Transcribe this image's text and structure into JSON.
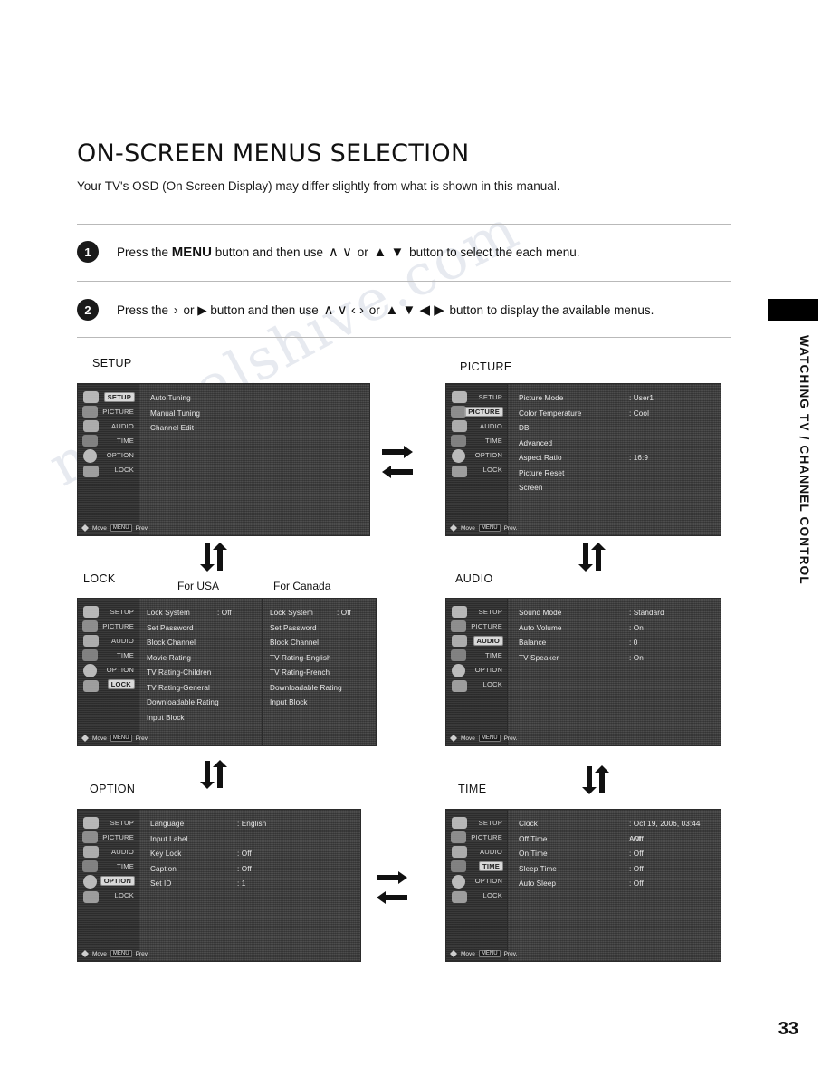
{
  "page": {
    "title": "ON-SCREEN MENUS SELECTION",
    "intro": "Your TV's OSD (On Screen Display) may differ slightly from what is shown in this manual.",
    "number": "33",
    "side_tab_text": "WATCHING TV / CHANNEL CONTROL",
    "watermark": "manualshive.com"
  },
  "steps": [
    {
      "num": "1",
      "pre": "Press the ",
      "key": "MENU",
      "mid": " button and then use ",
      "keys1": "∧ ∨",
      "or": " or ",
      "keys2": "▲ ▼",
      "post": " button to select the each menu."
    },
    {
      "num": "2",
      "pre": "Press the ",
      "key": "›",
      "mid": " or ▶ button and then use ",
      "keys1": "∧ ∨  ‹ ›",
      "or": " or ",
      "keys2": "▲ ▼ ◀ ▶",
      "post": " button to display the available menus."
    }
  ],
  "rail": {
    "items": [
      "SETUP",
      "PICTURE",
      "AUDIO",
      "TIME",
      "OPTION",
      "LOCK"
    ],
    "foot_move": "Move",
    "foot_key": "MENU",
    "foot_prev": "Prev."
  },
  "menus": {
    "setup": {
      "label": "SETUP",
      "selected": "SETUP",
      "rows": [
        {
          "k": "Auto Tuning",
          "v": ""
        },
        {
          "k": "Manual Tuning",
          "v": ""
        },
        {
          "k": "Channel Edit",
          "v": ""
        }
      ]
    },
    "picture": {
      "label": "PICTURE",
      "selected": "PICTURE",
      "rows": [
        {
          "k": "Picture Mode",
          "v": ": User1"
        },
        {
          "k": "Color Temperature",
          "v": ": Cool"
        },
        {
          "k": "DB",
          "v": ""
        },
        {
          "k": "Advanced",
          "v": ""
        },
        {
          "k": "Aspect Ratio",
          "v": ": 16:9"
        },
        {
          "k": "Picture Reset",
          "v": ""
        },
        {
          "k": "Screen",
          "v": ""
        }
      ]
    },
    "lock_usa": {
      "label": "LOCK",
      "caption": "For USA",
      "selected": "LOCK",
      "rows": [
        {
          "k": "Lock System",
          "v": ": Off"
        },
        {
          "k": "Set Password",
          "v": ""
        },
        {
          "k": "Block Channel",
          "v": ""
        },
        {
          "k": "Movie Rating",
          "v": ""
        },
        {
          "k": "TV Rating-Children",
          "v": ""
        },
        {
          "k": "TV Rating-General",
          "v": ""
        },
        {
          "k": "Downloadable Rating",
          "v": ""
        },
        {
          "k": "Input Block",
          "v": ""
        }
      ]
    },
    "lock_canada": {
      "caption": "For Canada",
      "rows": [
        {
          "k": "Lock System",
          "v": ": Off"
        },
        {
          "k": "Set Password",
          "v": ""
        },
        {
          "k": "Block Channel",
          "v": ""
        },
        {
          "k": "TV Rating-English",
          "v": ""
        },
        {
          "k": "TV Rating-French",
          "v": ""
        },
        {
          "k": "Downloadable Rating",
          "v": ""
        },
        {
          "k": "Input Block",
          "v": ""
        }
      ]
    },
    "audio": {
      "label": "AUDIO",
      "selected": "AUDIO",
      "rows": [
        {
          "k": "Sound Mode",
          "v": ": Standard"
        },
        {
          "k": "Auto Volume",
          "v": ": On"
        },
        {
          "k": "Balance",
          "v": ": 0"
        },
        {
          "k": "TV Speaker",
          "v": ": On"
        }
      ]
    },
    "option": {
      "label": "OPTION",
      "selected": "OPTION",
      "rows": [
        {
          "k": "Language",
          "v": ": English"
        },
        {
          "k": "Input Label",
          "v": ""
        },
        {
          "k": "Key Lock",
          "v": ": Off"
        },
        {
          "k": "Caption",
          "v": ": Off"
        },
        {
          "k": "Set ID",
          "v": ": 1"
        }
      ]
    },
    "time": {
      "label": "TIME",
      "selected": "TIME",
      "rows": [
        {
          "k": "Clock",
          "v": ": Oct 19, 2006, 03:44 AM"
        },
        {
          "k": "Off Time",
          "v": ": Off"
        },
        {
          "k": "On Time",
          "v": ": Off"
        },
        {
          "k": "Sleep Time",
          "v": ": Off"
        },
        {
          "k": "Auto Sleep",
          "v": ": Off"
        }
      ]
    }
  }
}
